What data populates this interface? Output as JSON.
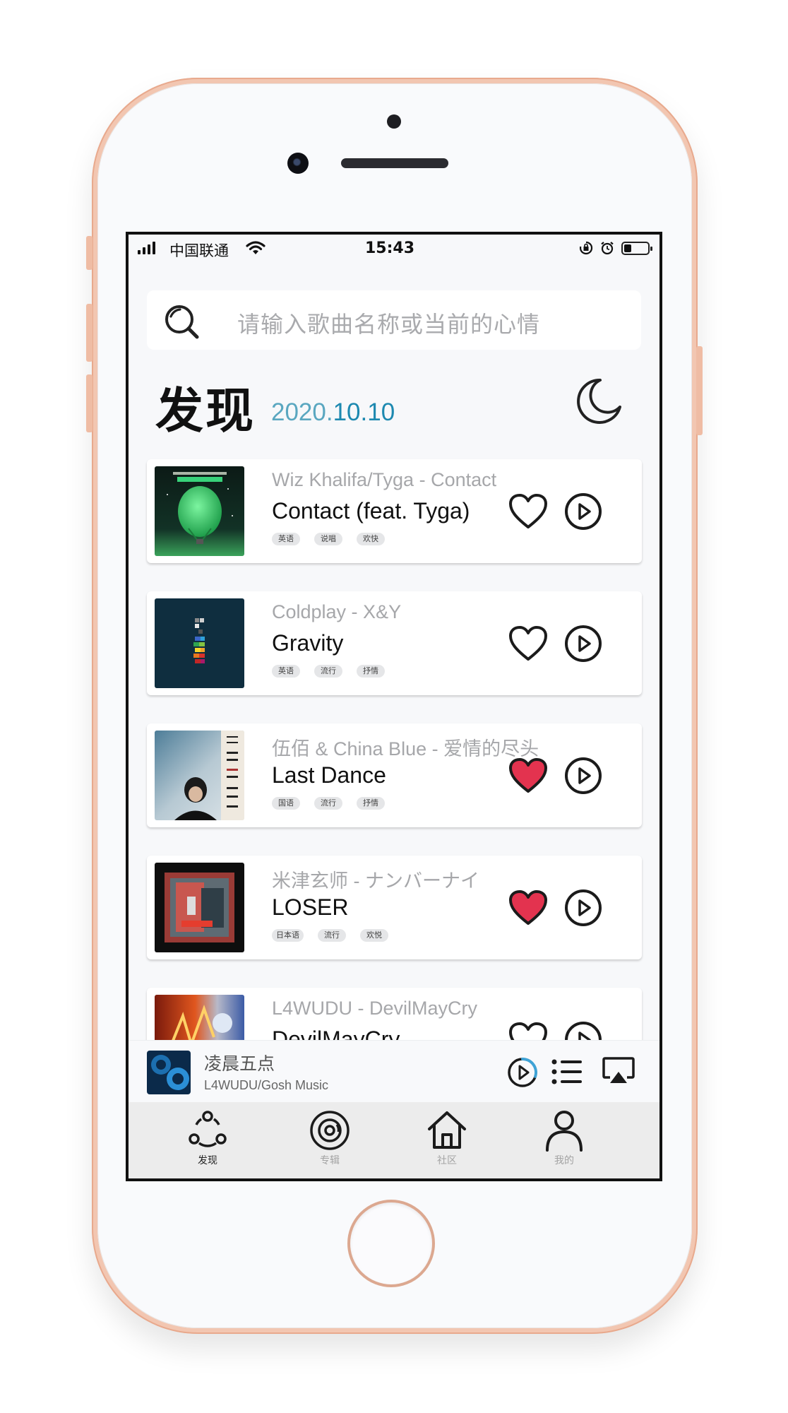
{
  "status_bar": {
    "carrier": "中国联通",
    "time": "15:43"
  },
  "search": {
    "placeholder": "请输入歌曲名称或当前的心情"
  },
  "header": {
    "title": "发现",
    "date_year": "2020.",
    "date_rest": "10.10"
  },
  "songs": [
    {
      "artist_album": "Wiz Khalifa/Tyga - Contact",
      "title": "Contact (feat. Tyga)",
      "tags": [
        "英语",
        "说唱",
        "欢快"
      ],
      "liked": false
    },
    {
      "artist_album": "Coldplay - X&Y",
      "title": "Gravity",
      "tags": [
        "英语",
        "流行",
        "抒情"
      ],
      "liked": false
    },
    {
      "artist_album": "伍佰 & China Blue - 爱情的尽头",
      "title": "Last Dance",
      "tags": [
        "国语",
        "流行",
        "抒情"
      ],
      "liked": true
    },
    {
      "artist_album": "米津玄师 - ナンバーナイ",
      "title": "LOSER",
      "tags": [
        "日本语",
        "流行",
        "欢悦"
      ],
      "liked": true
    },
    {
      "artist_album": "L4WUDU - DevilMayCry",
      "title": "DevilMayCry",
      "tags": [],
      "liked": false
    }
  ],
  "now_playing": {
    "title": "凌晨五点",
    "artist": "L4WUDU/Gosh Music",
    "progress_fraction": 0.3
  },
  "tabs": [
    {
      "label": "发现",
      "icon": "discover-icon",
      "active": true
    },
    {
      "label": "专辑",
      "icon": "album-disc-icon",
      "active": false
    },
    {
      "label": "社区",
      "icon": "home-icon",
      "active": false
    },
    {
      "label": "我的",
      "icon": "person-icon",
      "active": false
    }
  ],
  "colors": {
    "accent_blue": "#1d89b0",
    "like_red": "#e3334f",
    "progress_blue": "#3fa3d6"
  }
}
